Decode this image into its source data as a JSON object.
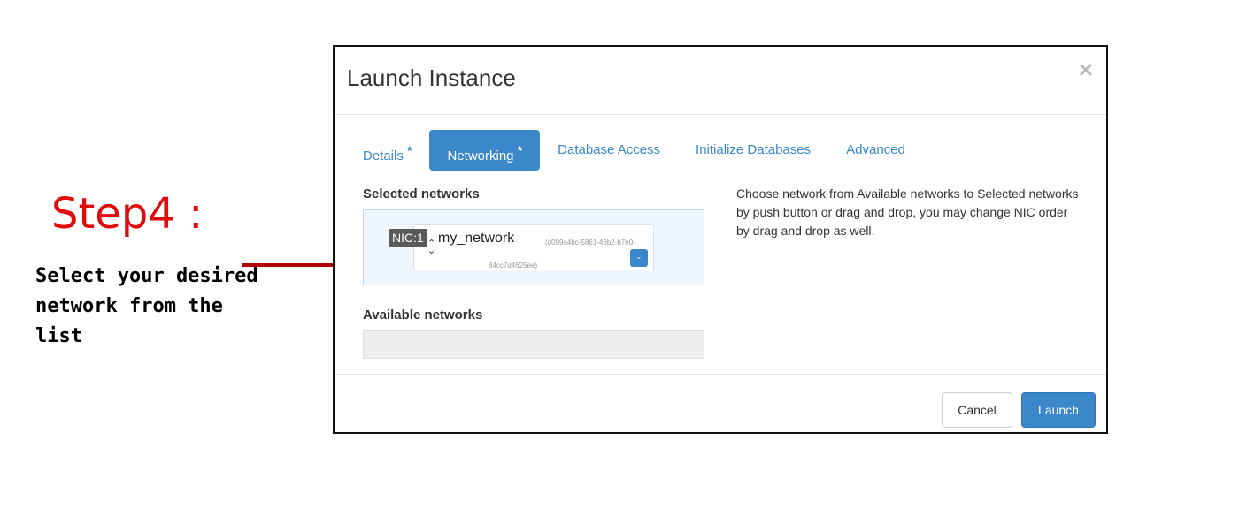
{
  "annotation": {
    "step_label": "Step4 :",
    "description": "Select your desired network from the list"
  },
  "modal": {
    "title": "Launch Instance",
    "close_symbol": "✕",
    "tabs": [
      {
        "label": "Details",
        "required": "*",
        "active": false
      },
      {
        "label": "Networking",
        "required": "*",
        "active": true
      },
      {
        "label": "Database Access",
        "required": "",
        "active": false
      },
      {
        "label": "Initialize Databases",
        "required": "",
        "active": false
      },
      {
        "label": "Advanced",
        "required": "",
        "active": false
      }
    ],
    "selected_networks": {
      "heading": "Selected networks",
      "items": [
        {
          "nic_label": "NIC:1",
          "name": "my_network",
          "id_part1": "(d099a4bc-5861-46b2-b7e0-",
          "id_part2": "84cc7d4625ee)",
          "remove_label": "-"
        }
      ]
    },
    "available_networks": {
      "heading": "Available networks"
    },
    "help_text": "Choose network from Available networks to Selected networks by push button or drag and drop, you may change NIC order by drag and drop as well.",
    "buttons": {
      "cancel": "Cancel",
      "launch": "Launch"
    }
  },
  "colors": {
    "accent": "#3a87c9",
    "annotation_red": "#e20b0b",
    "arrow": "#b00000"
  }
}
